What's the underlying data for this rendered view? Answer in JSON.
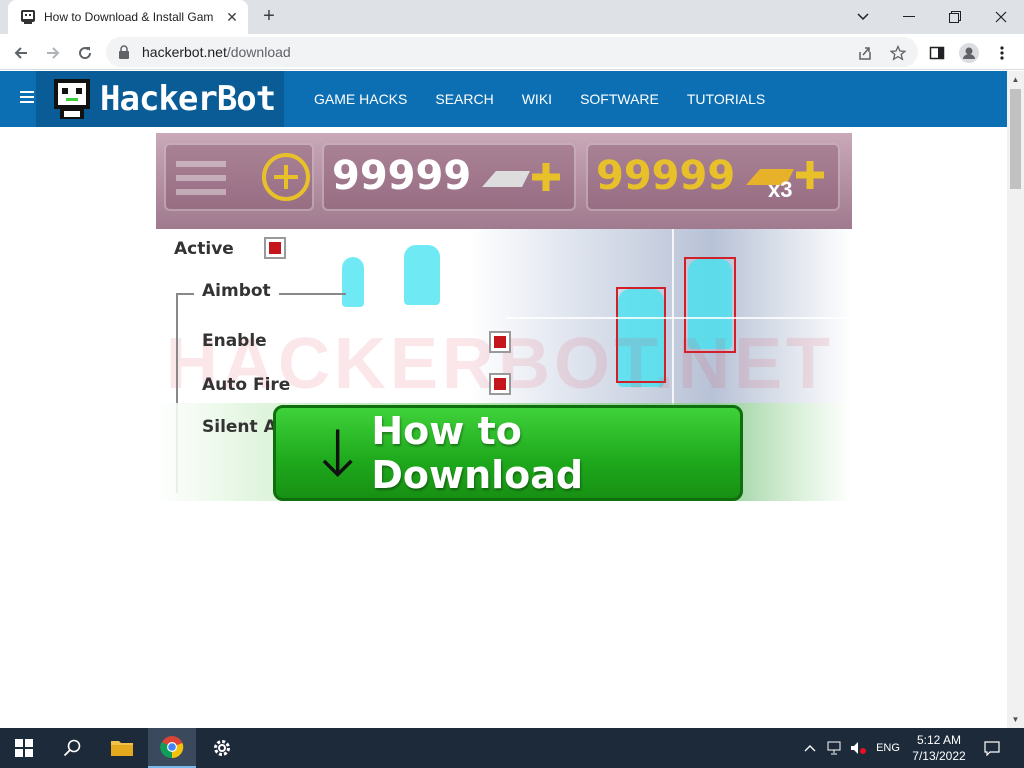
{
  "browser": {
    "tab_title": "How to Download & Install Gam",
    "close_tab": "✕",
    "new_tab": "+",
    "url_host": "hackerbot.net",
    "url_path": "/download"
  },
  "site": {
    "logo": "HackerBot",
    "nav": [
      "GAME HACKS",
      "SEARCH",
      "WIKI",
      "SOFTWARE",
      "TUTORIALS"
    ]
  },
  "banner": {
    "hud_value_1": "99999",
    "hud_value_2": "99999",
    "multiplier": "x3",
    "watermark": "HACKERBOT.NET",
    "active_label": "Active",
    "aimbot_label": "Aimbot",
    "enable_label": "Enable",
    "autofire_label": "Auto Fire",
    "silent_label": "Silent A",
    "download_button": "How to Download"
  },
  "taskbar": {
    "language": "ENG",
    "time": "5:12 AM",
    "date": "7/13/2022"
  },
  "colors": {
    "site_header": "#0d6fb3",
    "download_green": "#1ea81c",
    "checkbox_red": "#c4161c",
    "hud_gold": "#e8c12a"
  }
}
